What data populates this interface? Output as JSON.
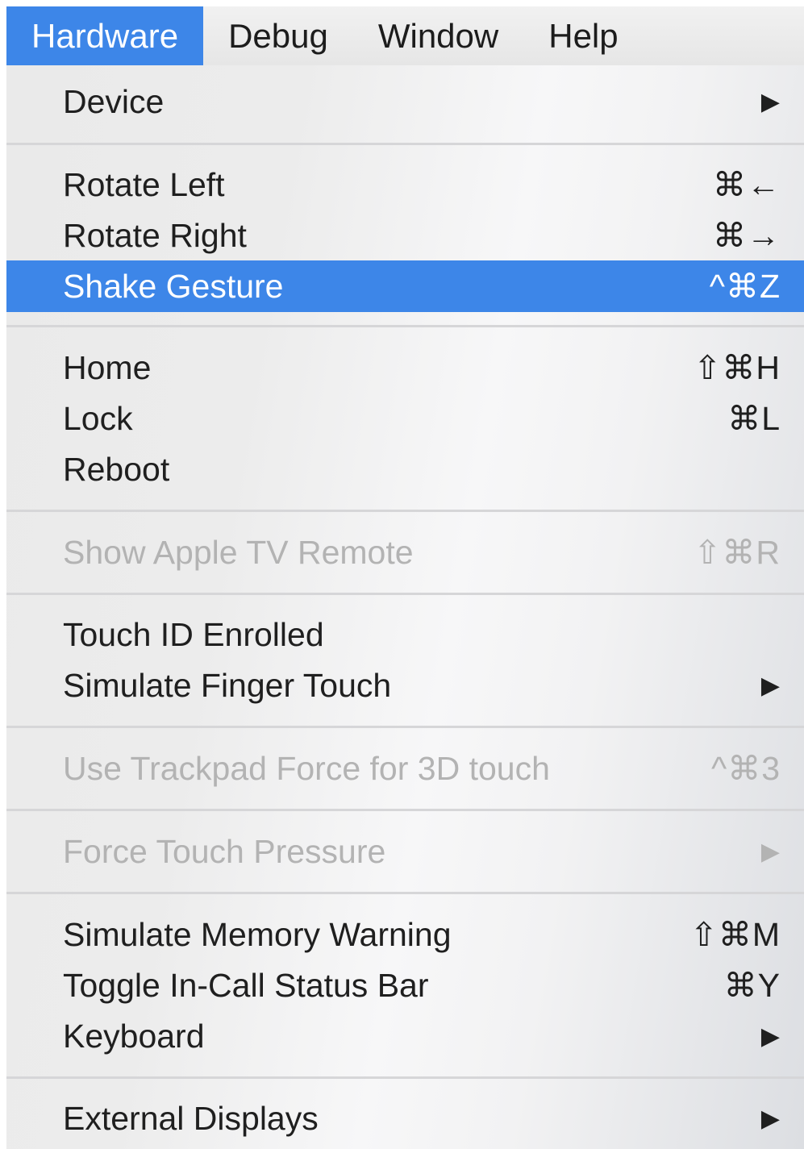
{
  "menubar": {
    "items": [
      {
        "label": "Hardware"
      },
      {
        "label": "Debug"
      },
      {
        "label": "Window"
      },
      {
        "label": "Help"
      }
    ]
  },
  "menu": {
    "items": [
      {
        "label": "Device",
        "shortcut": "",
        "submenu": true,
        "submenu_icon": "▶",
        "enabled": true
      },
      {
        "label": "Rotate Left",
        "shortcut": "⌘←",
        "enabled": true
      },
      {
        "label": "Rotate Right",
        "shortcut": "⌘→",
        "enabled": true
      },
      {
        "label": "Shake Gesture",
        "shortcut": "^⌘Z",
        "enabled": true,
        "highlighted": true
      },
      {
        "label": "Home",
        "shortcut": "⇧⌘H",
        "enabled": true
      },
      {
        "label": "Lock",
        "shortcut": "⌘L",
        "enabled": true
      },
      {
        "label": "Reboot",
        "shortcut": "",
        "enabled": true
      },
      {
        "label": "Show Apple TV Remote",
        "shortcut": "⇧⌘R",
        "enabled": false
      },
      {
        "label": "Touch ID Enrolled",
        "shortcut": "",
        "enabled": true
      },
      {
        "label": "Simulate Finger Touch",
        "shortcut": "",
        "submenu": true,
        "submenu_icon": "▶",
        "enabled": true
      },
      {
        "label": "Use Trackpad Force for 3D touch",
        "shortcut": "^⌘3",
        "enabled": false
      },
      {
        "label": "Force Touch Pressure",
        "shortcut": "",
        "submenu": true,
        "submenu_icon": "▶",
        "enabled": false
      },
      {
        "label": "Simulate Memory Warning",
        "shortcut": "⇧⌘M",
        "enabled": true
      },
      {
        "label": "Toggle In-Call Status Bar",
        "shortcut": "⌘Y",
        "enabled": true
      },
      {
        "label": "Keyboard",
        "shortcut": "",
        "submenu": true,
        "submenu_icon": "▶",
        "enabled": true
      },
      {
        "label": "External Displays",
        "shortcut": "",
        "submenu": true,
        "submenu_icon": "▶",
        "enabled": true
      }
    ]
  },
  "colors": {
    "highlight": "#3d86e8",
    "disabled_text": "#b3b3b3",
    "text": "#1f1f1f"
  }
}
